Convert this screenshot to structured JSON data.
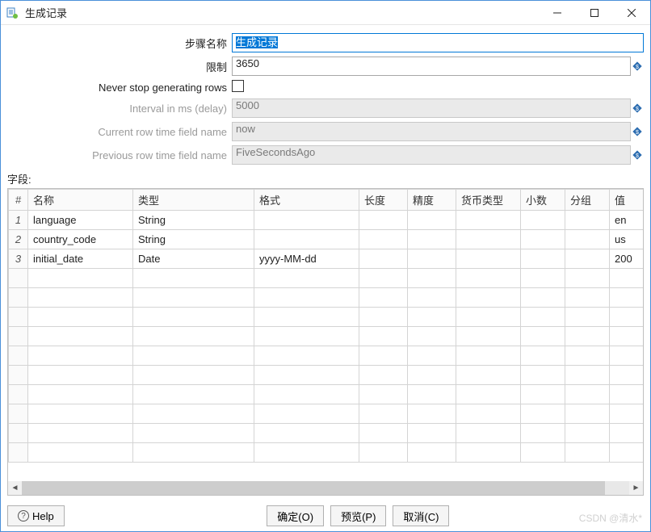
{
  "window": {
    "title": "生成记录"
  },
  "form": {
    "step_name_label": "步骤名称",
    "step_name_value": "生成记录",
    "limit_label": "限制",
    "limit_value": "3650",
    "never_stop_label": "Never stop generating rows",
    "never_stop_checked": false,
    "interval_label": "Interval in ms (delay)",
    "interval_value": "5000",
    "current_row_label": "Current row time field name",
    "current_row_value": "now",
    "previous_row_label": "Previous row time field name",
    "previous_row_value": "FiveSecondsAgo"
  },
  "fields_section_label": "字段:",
  "table": {
    "headers": {
      "rownum": "#",
      "name": "名称",
      "type": "类型",
      "format": "格式",
      "length": "长度",
      "precision": "精度",
      "currency": "货币类型",
      "decimal": "小数",
      "group": "分组",
      "value": "值"
    },
    "rows": [
      {
        "n": "1",
        "name": "language",
        "type": "String",
        "format": "",
        "length": "",
        "precision": "",
        "currency": "",
        "decimal": "",
        "group": "",
        "value": "en"
      },
      {
        "n": "2",
        "name": "country_code",
        "type": "String",
        "format": "",
        "length": "",
        "precision": "",
        "currency": "",
        "decimal": "",
        "group": "",
        "value": "us"
      },
      {
        "n": "3",
        "name": "initial_date",
        "type": "Date",
        "format": "yyyy-MM-dd",
        "length": "",
        "precision": "",
        "currency": "",
        "decimal": "",
        "group": "",
        "value": "200"
      }
    ]
  },
  "buttons": {
    "help": "Help",
    "ok": "确定(O)",
    "preview": "预览(P)",
    "cancel": "取消(C)"
  },
  "watermark": "CSDN @清水*",
  "colors": {
    "accent": "#0078d7"
  }
}
